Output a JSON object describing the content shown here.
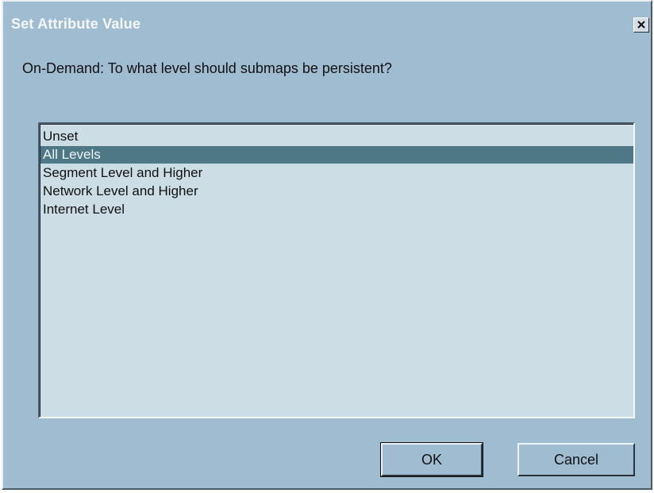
{
  "window": {
    "title": "Set Attribute Value",
    "close_icon": "close-icon"
  },
  "prompt": "On-Demand: To what level should submaps be persistent?",
  "list": {
    "items": [
      {
        "label": "Unset",
        "selected": false
      },
      {
        "label": "All Levels",
        "selected": true
      },
      {
        "label": "Segment Level and Higher",
        "selected": false
      },
      {
        "label": "Network Level and Higher",
        "selected": false
      },
      {
        "label": "Internet Level",
        "selected": false
      }
    ]
  },
  "buttons": {
    "ok_label": "OK",
    "cancel_label": "Cancel"
  },
  "colors": {
    "dialog_bg": "#a0bcd1",
    "list_bg": "#ccdde6",
    "selection": "#4f7887"
  }
}
